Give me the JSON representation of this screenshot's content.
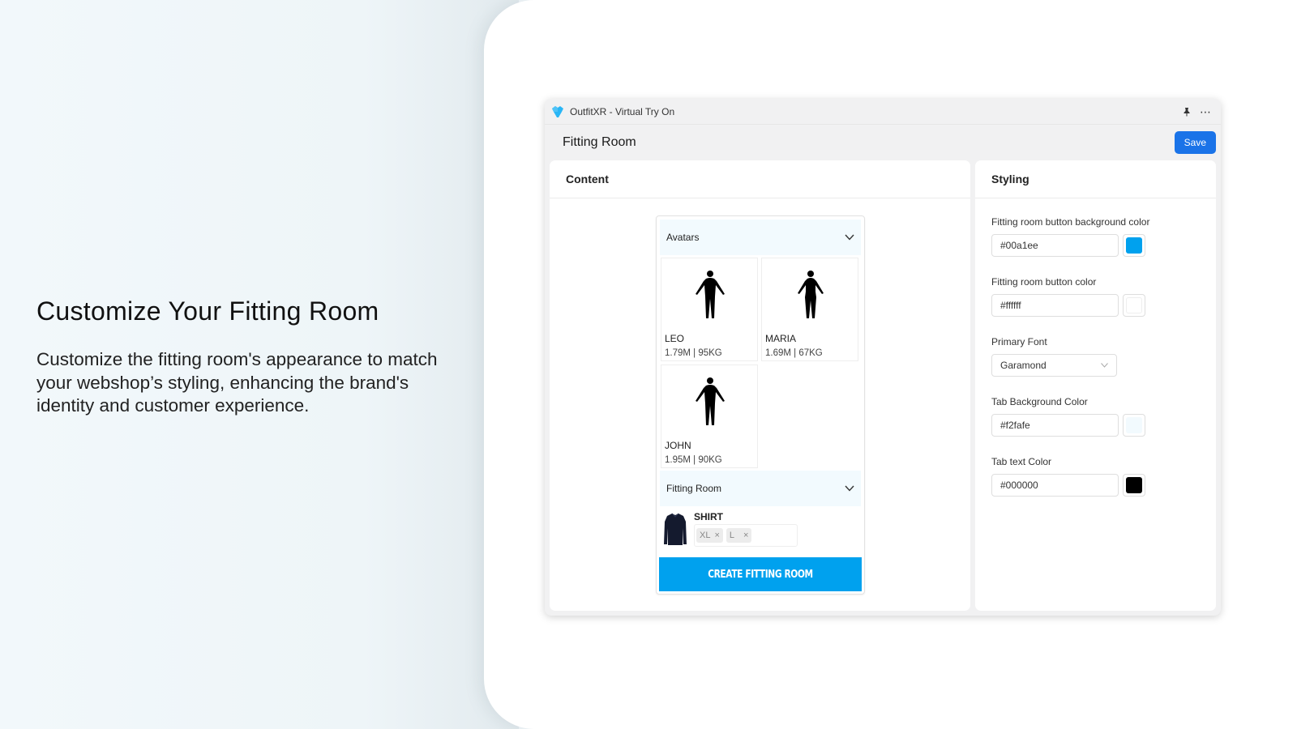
{
  "hero": {
    "title": "Customize Your Fitting Room",
    "description": "Customize the fitting room's appearance to match your webshop’s styling, enhancing the brand's identity and customer experience."
  },
  "window": {
    "app_title": "OutfitXR - Virtual Try On",
    "page_title": "Fitting Room",
    "save_label": "Save",
    "icons": [
      "outfitxr-logo-icon",
      "pin-icon",
      "more-icon"
    ]
  },
  "content_panel": {
    "title": "Content",
    "avatars_section": {
      "label": "Avatars",
      "items": [
        {
          "name": "LEO",
          "meta": "1.79M | 95KG"
        },
        {
          "name": "MARIA",
          "meta": "1.69M | 67KG"
        },
        {
          "name": "JOHN",
          "meta": "1.95M | 90KG"
        }
      ]
    },
    "fitting_room_section": {
      "label": "Fitting Room",
      "item": {
        "name": "SHIRT",
        "sizes": [
          "XL",
          "L"
        ]
      }
    },
    "create_button_label": "CREATE FITTING ROOM"
  },
  "styling_panel": {
    "title": "Styling",
    "fields": [
      {
        "label": "Fitting room button background color",
        "value": "#00a1ee",
        "swatch": "#00a1ee"
      },
      {
        "label": "Fitting room button color",
        "value": "#ffffff",
        "swatch": "#ffffff"
      },
      {
        "label": "Tab Background Color",
        "value": "#f2fafe",
        "swatch": "#f2fafe"
      },
      {
        "label": "Tab text Color",
        "value": "#000000",
        "swatch": "#000000"
      }
    ],
    "primary_font": {
      "label": "Primary Font",
      "value": "Garamond"
    }
  },
  "colors": {
    "accent": "#00a1ee",
    "save_button": "#1a73e8",
    "tab_background": "#f2fafe"
  }
}
